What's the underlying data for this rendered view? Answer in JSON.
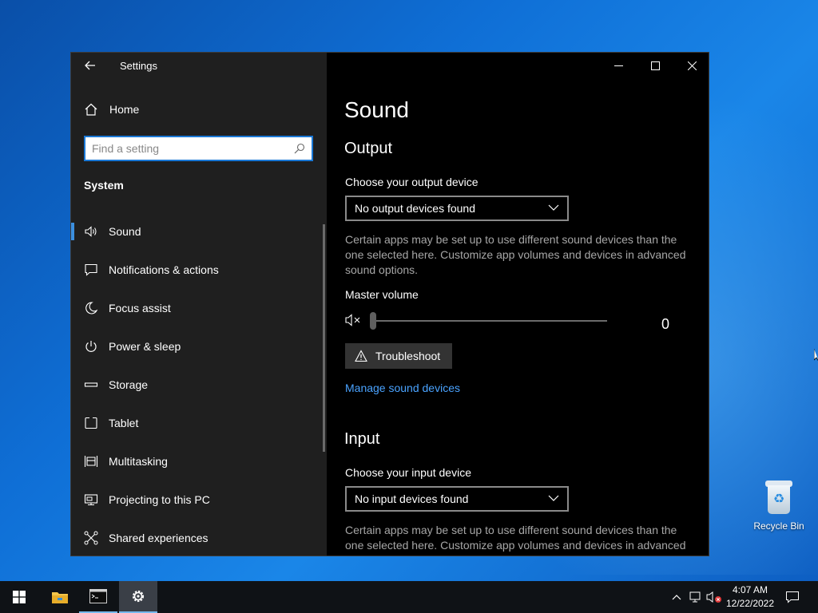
{
  "window": {
    "app_title": "Settings",
    "controls": {
      "minimize": "─",
      "maximize": "☐",
      "close": "✕"
    }
  },
  "sidebar": {
    "home_label": "Home",
    "search_placeholder": "Find a setting",
    "group_title": "System",
    "items": [
      {
        "label": "Sound",
        "icon": "speaker-icon",
        "active": true
      },
      {
        "label": "Notifications & actions",
        "icon": "notification-icon"
      },
      {
        "label": "Focus assist",
        "icon": "moon-icon"
      },
      {
        "label": "Power & sleep",
        "icon": "power-icon"
      },
      {
        "label": "Storage",
        "icon": "storage-icon"
      },
      {
        "label": "Tablet",
        "icon": "tablet-icon"
      },
      {
        "label": "Multitasking",
        "icon": "multitasking-icon"
      },
      {
        "label": "Projecting to this PC",
        "icon": "projecting-icon"
      },
      {
        "label": "Shared experiences",
        "icon": "shared-icon"
      }
    ]
  },
  "main": {
    "page_title": "Sound",
    "output": {
      "title": "Output",
      "device_label": "Choose your output device",
      "device_value": "No output devices found",
      "description": "Certain apps may be set up to use different sound devices than the one selected here. Customize app volumes and devices in advanced sound options.",
      "master_volume_label": "Master volume",
      "volume_value": "0",
      "volume_level": 0,
      "troubleshoot_label": "Troubleshoot",
      "manage_link": "Manage sound devices"
    },
    "input": {
      "title": "Input",
      "device_label": "Choose your input device",
      "device_value": "No input devices found",
      "description": "Certain apps may be set up to use different sound devices than the one selected here. Customize app volumes and devices in advanced"
    }
  },
  "desktop": {
    "recycle_bin_label": "Recycle Bin"
  },
  "taskbar": {
    "time": "4:07 AM",
    "date": "12/22/2022"
  },
  "colors": {
    "accent": "#1a78d6",
    "link": "#4aa3ff",
    "sidebar_bg": "#1f1f1f",
    "main_bg": "#000000"
  }
}
